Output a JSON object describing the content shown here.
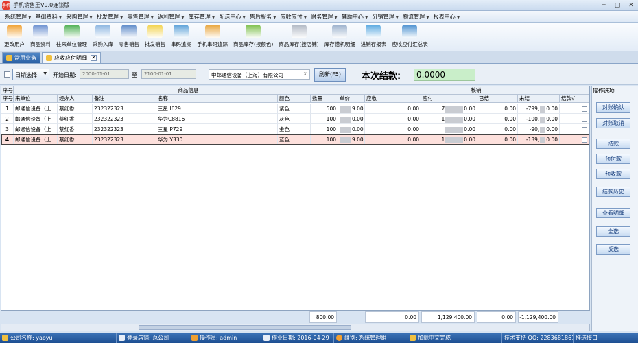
{
  "app": {
    "title": "手机销售王V9.0连锁版",
    "logo_text": "手机"
  },
  "window_controls": [
    "─",
    "▢",
    "✕"
  ],
  "menu": [
    "系统管理",
    "基础资料",
    "采购管理",
    "批发管理",
    "零售管理",
    "返利管理",
    "库存管理",
    "配送中心",
    "售后服务",
    "应收应付",
    "财务管理",
    "辅助中心",
    "分销管理",
    "物流管理",
    "报表中心"
  ],
  "toolbar": [
    {
      "label": "更改用户",
      "icon": "change-user-icon",
      "color": "#f0a030"
    },
    {
      "label": "商品资料",
      "icon": "bar-chart-icon",
      "color": "#6a8fd0"
    },
    {
      "label": "往来单位管理",
      "icon": "pie-chart-icon",
      "color": "#4caf50"
    },
    {
      "label": "采购入库",
      "icon": "cloud-icon",
      "color": "#8ab4e0"
    },
    {
      "label": "零售销售",
      "icon": "monitor-icon",
      "color": "#5a88c8"
    },
    {
      "label": "批发销售",
      "icon": "folder-icon",
      "color": "#f2d24a"
    },
    {
      "label": "串码追溯",
      "icon": "refresh-icon",
      "color": "#5aa0d8"
    },
    {
      "label": "手机串码追踪",
      "icon": "shield-icon",
      "color": "#e8a43a"
    },
    {
      "label": "商品库存(按颜色)",
      "icon": "cube-icon",
      "color": "#7cbf4a"
    },
    {
      "label": "商品库存(按店铺)",
      "icon": "gear-icon",
      "color": "#b0b8c4"
    },
    {
      "label": "库存借机明细",
      "icon": "magnifier-icon",
      "color": "#9ab0cc"
    },
    {
      "label": "进销存报表",
      "icon": "blocks-icon",
      "color": "#58a8e0"
    },
    {
      "label": "应收应付汇总表",
      "icon": "screen-icon",
      "color": "#4a90d0"
    }
  ],
  "tabs": {
    "common": "常用业务",
    "active": "应收应付明细",
    "close": "✕"
  },
  "filter": {
    "date_select": "日期选择",
    "start_label": "开始日期:",
    "start_value": "2000-01-01",
    "to_label": "至",
    "end_value": "2100-01-01",
    "company": "中邮通信设备（上海）有限公司",
    "company_clear": "x",
    "refresh": "刷新(F5)",
    "settle_label": "本次结款:",
    "settle_value": "0.0000"
  },
  "grid": {
    "group_headers": {
      "seq": "序号",
      "goods": "商品信息",
      "verify": "核销"
    },
    "columns": [
      "序号",
      "来单位",
      "经办人",
      "备注",
      "名称",
      "颜色",
      "数量",
      "单价",
      "应收",
      "应付",
      "已结",
      "未结",
      "结款√"
    ],
    "rows": [
      {
        "seq": "1",
        "unit": "邮通信设备（上",
        "handler": "蔡红香",
        "note": "232322323",
        "name": "三星 I629",
        "color": "紫色",
        "qty": "500",
        "price_a": "",
        "price_b": "9.00",
        "recv": "0.00",
        "pay_a": "7",
        "pay_b": "0.00",
        "settled": "0.00",
        "unsettled_a": "-799,",
        "unsettled_b": "0.00"
      },
      {
        "seq": "2",
        "unit": "邮通信设备（上",
        "handler": "蔡红香",
        "note": "232322323",
        "name": "华为C8816",
        "color": "灰色",
        "qty": "100",
        "price_a": "",
        "price_b": "0.00",
        "recv": "0.00",
        "pay_a": "1",
        "pay_b": "0.00",
        "settled": "0.00",
        "unsettled_a": "-100,",
        "unsettled_b": "0.00"
      },
      {
        "seq": "3",
        "unit": "邮通信设备（上",
        "handler": "蔡红香",
        "note": "232322323",
        "name": "三星 P729",
        "color": "金色",
        "qty": "100",
        "price_a": "",
        "price_b": "0.00",
        "recv": "0.00",
        "pay_a": "",
        "pay_b": "0.00",
        "settled": "0.00",
        "unsettled_a": "-90,",
        "unsettled_b": "0.00"
      },
      {
        "seq": "4",
        "unit": "邮通信设备（上",
        "handler": "蔡红香",
        "note": "232322323",
        "name": "华为 Y330",
        "color": "蓝色",
        "qty": "100",
        "price_a": "",
        "price_b": "9.00",
        "recv": "0.00",
        "pay_a": "1",
        "pay_b": "0.00",
        "settled": "0.00",
        "unsettled_a": "-139,",
        "unsettled_b": "0.00"
      }
    ],
    "totals": {
      "qty": "800.00",
      "recv": "0.00",
      "pay": "1,129,400.00",
      "settled": "0.00",
      "unsettled": "-1,129,400.00"
    }
  },
  "side_panel": {
    "title": "操作选项",
    "buttons": [
      "对账确认",
      "对账取消",
      "结款",
      "预付款",
      "预收款",
      "结款历史",
      "查看明细",
      "全选",
      "反选"
    ]
  },
  "status": {
    "company": "公司名称: yaoyu",
    "store": "登录店铺: 总公司",
    "operator": "操作员: admin",
    "workdate": "作业日期: 2016-04-29",
    "group": "组别: 系统管理组",
    "locale": "加载中文完成",
    "support": "技术支持 QQ: 2283681861",
    "port": "推送接口"
  },
  "colors": {
    "accent": "#2c62a5",
    "status_bg": "#1d4e91",
    "row_highlight": "#fde0dc",
    "settle_bg": "#c9eec9"
  }
}
